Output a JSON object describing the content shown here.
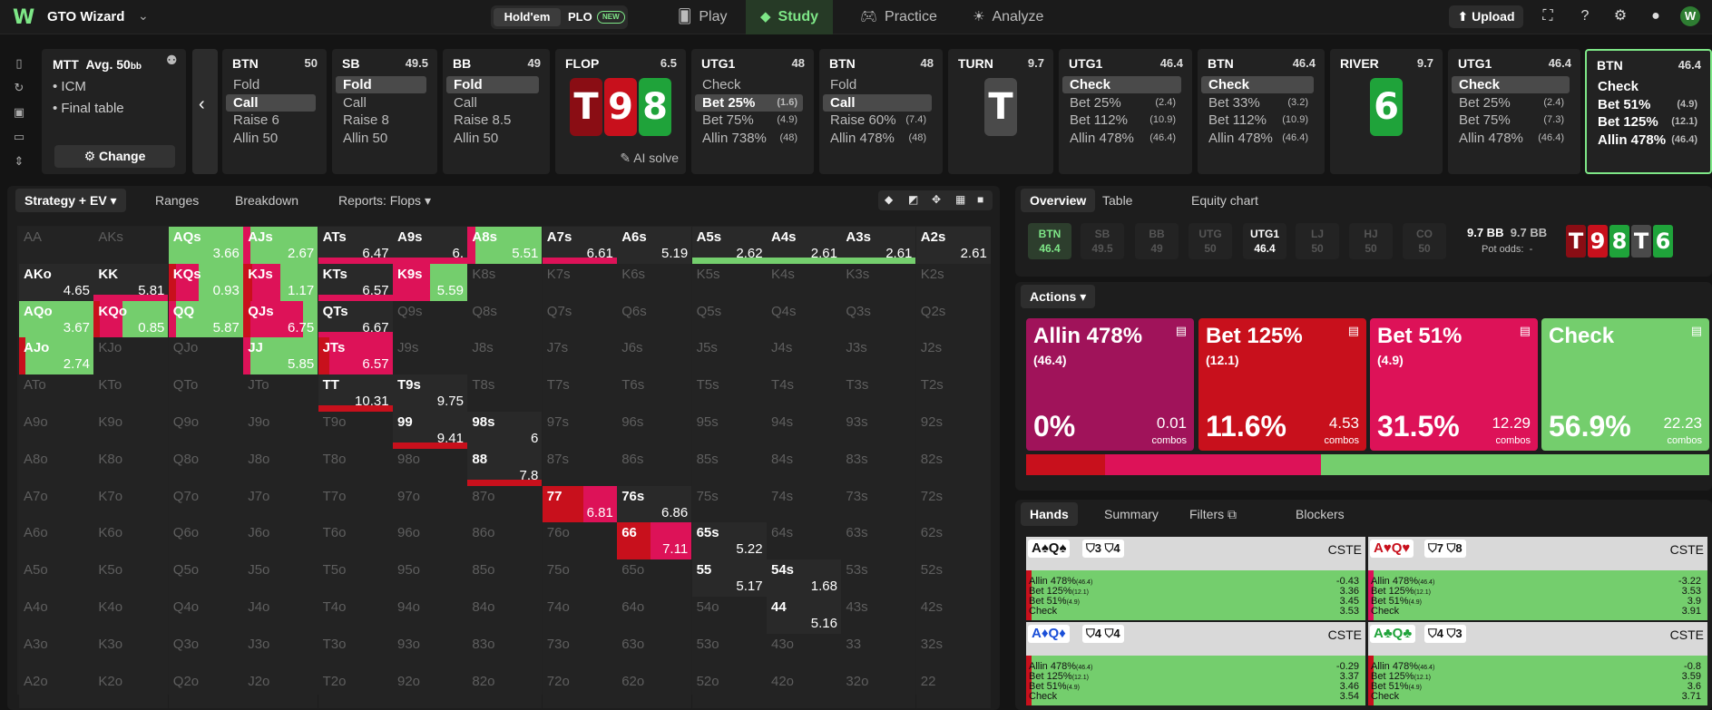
{
  "app": {
    "name": "GTO Wizard",
    "game_tabs": [
      "Hold'em",
      "PLO"
    ],
    "new_badge": "NEW",
    "nav": [
      "Play",
      "Study",
      "Practice",
      "Analyze"
    ],
    "upload": "Upload",
    "avatar": "W"
  },
  "spot": {
    "format": "MTT",
    "avg_label": "Avg. 50",
    "avg_unit": "bb",
    "tags": [
      "ICM",
      "Final table"
    ],
    "change": "Change"
  },
  "strip": [
    {
      "pos": "BTN",
      "stack": "50",
      "actions": [
        "Fold",
        "Call",
        "Raise 6",
        "Allin 50"
      ],
      "selected": 1
    },
    {
      "pos": "SB",
      "stack": "49.5",
      "actions": [
        "Fold",
        "Call",
        "Raise 8",
        "Allin 50"
      ],
      "selected": 0
    },
    {
      "pos": "BB",
      "stack": "49",
      "actions": [
        "Fold",
        "Call",
        "Raise 8.5",
        "Allin 50"
      ],
      "selected": 0
    },
    {
      "street": "FLOP",
      "pot": "6.5",
      "cards": [
        "T",
        "9",
        "8"
      ],
      "ai": "AI solve"
    },
    {
      "pos": "UTG1",
      "stack": "48",
      "actions": [
        [
          "Check",
          ""
        ],
        [
          "Bet 25%",
          "(1.6)"
        ],
        [
          "Bet 75%",
          "(4.9)"
        ],
        [
          "Allin 738%",
          "(48)"
        ]
      ],
      "selected": 1
    },
    {
      "pos": "BTN",
      "stack": "48",
      "actions": [
        [
          "Fold",
          ""
        ],
        [
          "Call",
          ""
        ],
        [
          "Raise 60%",
          "(7.4)"
        ],
        [
          "Allin 478%",
          "(48)"
        ]
      ],
      "selected": 1
    },
    {
      "street": "TURN",
      "pot": "9.7",
      "cards": [
        "T"
      ]
    },
    {
      "pos": "UTG1",
      "stack": "46.4",
      "actions": [
        [
          "Check",
          ""
        ],
        [
          "Bet 25%",
          "(2.4)"
        ],
        [
          "Bet 112%",
          "(10.9)"
        ],
        [
          "Allin 478%",
          "(46.4)"
        ]
      ],
      "selected": 0
    },
    {
      "pos": "BTN",
      "stack": "46.4",
      "actions": [
        [
          "Check",
          ""
        ],
        [
          "Bet 33%",
          "(3.2)"
        ],
        [
          "Bet 112%",
          "(10.9)"
        ],
        [
          "Allin 478%",
          "(46.4)"
        ]
      ],
      "selected": 0
    },
    {
      "street": "RIVER",
      "pot": "9.7",
      "cards": [
        "6"
      ]
    },
    {
      "pos": "UTG1",
      "stack": "46.4",
      "actions": [
        [
          "Check",
          ""
        ],
        [
          "Bet 25%",
          "(2.4)"
        ],
        [
          "Bet 75%",
          "(7.3)"
        ],
        [
          "Allin 478%",
          "(46.4)"
        ]
      ],
      "selected": 0
    },
    {
      "pos": "BTN",
      "stack": "46.4",
      "actions": [
        [
          "Check",
          ""
        ],
        [
          "Bet 51%",
          "(4.9)"
        ],
        [
          "Bet 125%",
          "(12.1)"
        ],
        [
          "Allin 478%",
          "(46.4)"
        ]
      ],
      "selected": -1
    }
  ],
  "strat_tabs": [
    "Strategy + EV",
    "Ranges",
    "Breakdown",
    "Reports: Flops"
  ],
  "grid": {
    "labels": [
      "AA",
      "AKs",
      "AQs",
      "AJs",
      "ATs",
      "A9s",
      "A8s",
      "A7s",
      "A6s",
      "A5s",
      "A4s",
      "A3s",
      "A2s",
      "AKo",
      "KK",
      "KQs",
      "KJs",
      "KTs",
      "K9s",
      "K8s",
      "K7s",
      "K6s",
      "K5s",
      "K4s",
      "K3s",
      "K2s",
      "AQo",
      "KQo",
      "QQ",
      "QJs",
      "QTs",
      "Q9s",
      "Q8s",
      "Q7s",
      "Q6s",
      "Q5s",
      "Q4s",
      "Q3s",
      "Q2s",
      "AJo",
      "KJo",
      "QJo",
      "JJ",
      "JTs",
      "J9s",
      "J8s",
      "J7s",
      "J6s",
      "J5s",
      "J4s",
      "J3s",
      "J2s",
      "ATo",
      "KTo",
      "QTo",
      "JTo",
      "TT",
      "T9s",
      "T8s",
      "T7s",
      "T6s",
      "T5s",
      "T4s",
      "T3s",
      "T2s",
      "A9o",
      "K9o",
      "Q9o",
      "J9o",
      "T9o",
      "99",
      "98s",
      "97s",
      "96s",
      "95s",
      "94s",
      "93s",
      "92s",
      "A8o",
      "K8o",
      "Q8o",
      "J8o",
      "T8o",
      "98o",
      "88",
      "87s",
      "86s",
      "85s",
      "84s",
      "83s",
      "82s",
      "A7o",
      "K7o",
      "Q7o",
      "J7o",
      "T7o",
      "97o",
      "87o",
      "77",
      "76s",
      "75s",
      "74s",
      "73s",
      "72s",
      "A6o",
      "K6o",
      "Q6o",
      "J6o",
      "T6o",
      "96o",
      "86o",
      "76o",
      "66",
      "65s",
      "64s",
      "63s",
      "62s",
      "A5o",
      "K5o",
      "Q5o",
      "J5o",
      "T5o",
      "95o",
      "85o",
      "75o",
      "65o",
      "55",
      "54s",
      "53s",
      "52s",
      "A4o",
      "K4o",
      "Q4o",
      "J4o",
      "T4o",
      "94o",
      "84o",
      "74o",
      "64o",
      "54o",
      "44",
      "43s",
      "42s",
      "A3o",
      "K3o",
      "Q3o",
      "J3o",
      "T3o",
      "93o",
      "83o",
      "73o",
      "63o",
      "53o",
      "43o",
      "33",
      "32s",
      "A2o",
      "K2o",
      "Q2o",
      "J2o",
      "T2o",
      "92o",
      "82o",
      "72o",
      "62o",
      "52o",
      "42o",
      "32o",
      "22"
    ],
    "ev": {
      "AQs": "3.66",
      "AJs": "2.67",
      "ATs": "6.47",
      "A9s": "6.",
      "A8s": "5.51",
      "A7s": "6.61",
      "A6s": "5.19",
      "A5s": "2.62",
      "A4s": "2.61",
      "A3s": "2.61",
      "A2s": "2.61",
      "AKo": "4.65",
      "KK": "5.81",
      "KQs": "0.93",
      "KJs": "1.17",
      "KTs": "6.57",
      "K9s": "5.59",
      "AQo": "3.67",
      "KQo": "0.85",
      "QQ": "5.87",
      "QJs": "6.75",
      "QTs": "6.67",
      "AJo": "2.74",
      "JJ": "5.85",
      "JTs": "6.57",
      "TT": "10.31",
      "T9s": "9.75",
      "99": "9.41",
      "98s": "6",
      "88": "7.8",
      "77": "6.81",
      "76s": "6.86",
      "66": "7.11",
      "65s": "5.22",
      "55": "5.17",
      "54s": "1.68",
      "44": "5.16"
    }
  },
  "right_tabs": [
    "Overview",
    "Table",
    "Equity chart"
  ],
  "positions": [
    [
      "BTN",
      "46.4"
    ],
    [
      "SB",
      "49.5"
    ],
    [
      "BB",
      "49"
    ],
    [
      "UTG",
      "50"
    ],
    [
      "UTG1",
      "46.4"
    ],
    [
      "LJ",
      "50"
    ],
    [
      "HJ",
      "50"
    ],
    [
      "CO",
      "50"
    ]
  ],
  "pot": {
    "a": "9.7 BB",
    "b": "9.7 BB",
    "odds_label": "Pot odds:",
    "odds": "-"
  },
  "board": [
    "T",
    "9",
    "8",
    "T",
    "6"
  ],
  "actions_label": "Actions",
  "actions": [
    {
      "name": "Allin 478%",
      "size": "(46.4)",
      "freq": "0%",
      "combos": "0.01",
      "color": "#a0135a"
    },
    {
      "name": "Bet 125%",
      "size": "(12.1)",
      "freq": "11.6%",
      "combos": "4.53",
      "color": "#c8101c"
    },
    {
      "name": "Bet 51%",
      "size": "(4.9)",
      "freq": "31.5%",
      "combos": "12.29",
      "color": "#dd1258"
    },
    {
      "name": "Check",
      "size": "",
      "freq": "56.9%",
      "combos": "22.23",
      "color": "#74ce6d"
    }
  ],
  "freqbar": [
    0.116,
    0.315,
    0.569
  ],
  "combos_label": "combos",
  "hands_tabs": [
    "Hands",
    "Summary",
    "Filters",
    "Blockers"
  ],
  "hands": [
    {
      "hand": "A♠Q♠",
      "b1": "3",
      "b2": "4",
      "tag": "CSTE",
      "rows": [
        [
          "Allin 478%",
          "(46.4)",
          "-0.43"
        ],
        [
          "Bet 125%",
          "(12.1)",
          "3.36"
        ],
        [
          "Bet 51%",
          "(4.9)",
          "3.45"
        ],
        [
          "Check",
          "",
          "3.53"
        ]
      ]
    },
    {
      "hand": "A♥Q♥",
      "b1": "7",
      "b2": "8",
      "tag": "CSTE",
      "rows": [
        [
          "Allin 478%",
          "(46.4)",
          "-3.22"
        ],
        [
          "Bet 125%",
          "(12.1)",
          "3.53"
        ],
        [
          "Bet 51%",
          "(4.9)",
          "3.9"
        ],
        [
          "Check",
          "",
          "3.91"
        ]
      ]
    },
    {
      "hand": "A♦Q♦",
      "b1": "4",
      "b2": "4",
      "tag": "CSTE",
      "rows": [
        [
          "Allin 478%",
          "(46.4)",
          "-0.29"
        ],
        [
          "Bet 125%",
          "(12.1)",
          "3.37"
        ],
        [
          "Bet 51%",
          "(4.9)",
          "3.46"
        ],
        [
          "Check",
          "",
          "3.54"
        ]
      ]
    },
    {
      "hand": "A♣Q♣",
      "b1": "4",
      "b2": "3",
      "tag": "CSTE",
      "rows": [
        [
          "Allin 478%",
          "(46.4)",
          "-0.8"
        ],
        [
          "Bet 125%",
          "(12.1)",
          "3.59"
        ],
        [
          "Bet 51%",
          "(4.9)",
          "3.6"
        ],
        [
          "Check",
          "",
          "3.71"
        ]
      ]
    }
  ]
}
